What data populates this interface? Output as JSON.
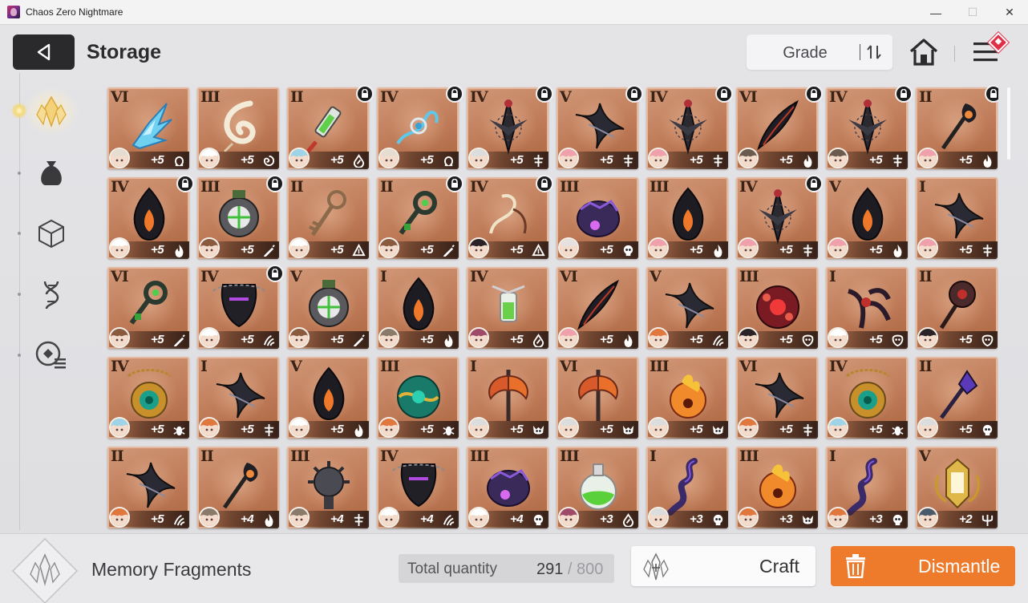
{
  "window": {
    "title": "Chaos Zero Nightmare",
    "minimize_glyph": "—",
    "maximize_glyph": "☐",
    "close_glyph": "✕"
  },
  "header": {
    "title": "Storage",
    "sort_label": "Grade"
  },
  "sidebar": {
    "tabs": [
      {
        "name": "memory-fragments",
        "icon": "crystal-icon",
        "active": true
      },
      {
        "name": "materials",
        "icon": "pouch-icon",
        "active": false
      },
      {
        "name": "items",
        "icon": "cube-icon",
        "active": false
      },
      {
        "name": "genes",
        "icon": "dna-icon",
        "active": false
      },
      {
        "name": "records",
        "icon": "disc-list-icon",
        "active": false
      }
    ]
  },
  "colors": {
    "card_bg": "#c0805d",
    "dismantle": "#ee7a2c",
    "back_button": "#2a2a2c",
    "notification": "#e03048"
  },
  "fragments": [
    {
      "grade": "VI",
      "locked": false,
      "level": "+5",
      "attr": "ohm",
      "art": "blue-crystal"
    },
    {
      "grade": "III",
      "locked": false,
      "level": "+5",
      "attr": "swirl",
      "art": "feather-swirl"
    },
    {
      "grade": "II",
      "locked": true,
      "level": "+5",
      "attr": "drop",
      "art": "green-syringe"
    },
    {
      "grade": "IV",
      "locked": true,
      "level": "+5",
      "attr": "ohm",
      "art": "blue-vines"
    },
    {
      "grade": "IV",
      "locked": true,
      "level": "+5",
      "attr": "cross",
      "art": "dark-blade"
    },
    {
      "grade": "V",
      "locked": true,
      "level": "+5",
      "attr": "cross",
      "art": "dark-claws"
    },
    {
      "grade": "IV",
      "locked": true,
      "level": "+5",
      "attr": "cross",
      "art": "dark-blade"
    },
    {
      "grade": "VI",
      "locked": true,
      "level": "+5",
      "attr": "flame",
      "art": "dark-feather"
    },
    {
      "grade": "IV",
      "locked": true,
      "level": "+5",
      "attr": "cross",
      "art": "dark-blade"
    },
    {
      "grade": "II",
      "locked": true,
      "level": "+5",
      "attr": "flame",
      "art": "dark-staff"
    },
    {
      "grade": "IV",
      "locked": true,
      "level": "+5",
      "attr": "flame",
      "art": "dark-flame"
    },
    {
      "grade": "III",
      "locked": true,
      "level": "+5",
      "attr": "pen",
      "art": "mech-orb"
    },
    {
      "grade": "II",
      "locked": false,
      "level": "+5",
      "attr": "tri",
      "art": "brass-key"
    },
    {
      "grade": "II",
      "locked": true,
      "level": "+5",
      "attr": "pen",
      "art": "green-key"
    },
    {
      "grade": "IV",
      "locked": true,
      "level": "+5",
      "attr": "tri",
      "art": "bone-whip"
    },
    {
      "grade": "III",
      "locked": false,
      "level": "+5",
      "attr": "skull",
      "art": "purple-beast"
    },
    {
      "grade": "III",
      "locked": false,
      "level": "+5",
      "attr": "flame",
      "art": "dark-flame"
    },
    {
      "grade": "IV",
      "locked": true,
      "level": "+5",
      "attr": "cross",
      "art": "dark-blade"
    },
    {
      "grade": "V",
      "locked": false,
      "level": "+5",
      "attr": "flame",
      "art": "dark-flame"
    },
    {
      "grade": "I",
      "locked": false,
      "level": "+5",
      "attr": "cross",
      "art": "dark-claws"
    },
    {
      "grade": "VI",
      "locked": false,
      "level": "+5",
      "attr": "pen",
      "art": "green-key"
    },
    {
      "grade": "IV",
      "locked": true,
      "level": "+5",
      "attr": "claw",
      "art": "chain-helm"
    },
    {
      "grade": "V",
      "locked": false,
      "level": "+5",
      "attr": "pen",
      "art": "mech-orb"
    },
    {
      "grade": "I",
      "locked": false,
      "level": "+5",
      "attr": "flame",
      "art": "dark-flame"
    },
    {
      "grade": "IV",
      "locked": false,
      "level": "+5",
      "attr": "drop",
      "art": "green-vial"
    },
    {
      "grade": "VI",
      "locked": false,
      "level": "+5",
      "attr": "flame",
      "art": "dark-feather"
    },
    {
      "grade": "V",
      "locked": false,
      "level": "+5",
      "attr": "claw",
      "art": "dark-claws"
    },
    {
      "grade": "III",
      "locked": false,
      "level": "+5",
      "attr": "beast",
      "art": "red-orb"
    },
    {
      "grade": "I",
      "locked": false,
      "level": "+5",
      "attr": "beast",
      "art": "red-claws"
    },
    {
      "grade": "II",
      "locked": false,
      "level": "+5",
      "attr": "beast",
      "art": "red-staff"
    },
    {
      "grade": "IV",
      "locked": false,
      "level": "+5",
      "attr": "bug",
      "art": "jade-amulet"
    },
    {
      "grade": "I",
      "locked": false,
      "level": "+5",
      "attr": "cross",
      "art": "dark-claws"
    },
    {
      "grade": "V",
      "locked": false,
      "level": "+5",
      "attr": "flame",
      "art": "dark-flame"
    },
    {
      "grade": "III",
      "locked": false,
      "level": "+5",
      "attr": "bug",
      "art": "jade-orb"
    },
    {
      "grade": "I",
      "locked": false,
      "level": "+5",
      "attr": "demon",
      "art": "fire-axe"
    },
    {
      "grade": "VI",
      "locked": false,
      "level": "+5",
      "attr": "demon",
      "art": "fire-axe"
    },
    {
      "grade": "III",
      "locked": false,
      "level": "+5",
      "attr": "demon",
      "art": "fire-orb"
    },
    {
      "grade": "VI",
      "locked": false,
      "level": "+5",
      "attr": "cross",
      "art": "dark-claws"
    },
    {
      "grade": "IV",
      "locked": false,
      "level": "+5",
      "attr": "bug",
      "art": "jade-amulet"
    },
    {
      "grade": "II",
      "locked": false,
      "level": "+5",
      "attr": "skull",
      "art": "purple-staff"
    },
    {
      "grade": "II",
      "locked": false,
      "level": "+5",
      "attr": "claw",
      "art": "dark-claws"
    },
    {
      "grade": "II",
      "locked": false,
      "level": "+4",
      "attr": "flame",
      "art": "dark-staff"
    },
    {
      "grade": "III",
      "locked": false,
      "level": "+4",
      "attr": "cross",
      "art": "spike-mace"
    },
    {
      "grade": "IV",
      "locked": false,
      "level": "+4",
      "attr": "claw",
      "art": "chain-helm"
    },
    {
      "grade": "III",
      "locked": false,
      "level": "+4",
      "attr": "skull",
      "art": "purple-beast"
    },
    {
      "grade": "III",
      "locked": false,
      "level": "+3",
      "attr": "drop",
      "art": "green-flask"
    },
    {
      "grade": "I",
      "locked": false,
      "level": "+3",
      "attr": "skull",
      "art": "purple-serpent"
    },
    {
      "grade": "III",
      "locked": false,
      "level": "+3",
      "attr": "demon",
      "art": "fire-orb"
    },
    {
      "grade": "I",
      "locked": false,
      "level": "+3",
      "attr": "skull",
      "art": "purple-serpent"
    },
    {
      "grade": "V",
      "locked": false,
      "level": "+2",
      "attr": "trident",
      "art": "gold-lantern"
    }
  ],
  "avatar_colors": [
    "#e6ddd2",
    "#ffffff",
    "#9fd3e6",
    "#e6ddd2",
    "#dcdcdc",
    "#f0a0aa",
    "#f0a0aa",
    "#6b5a4e",
    "#6b5a4e",
    "#f0a0aa",
    "#ffffff",
    "#8a5a3e",
    "#ffffff",
    "#8a5a3e",
    "#2a2226",
    "#e6e0e0",
    "#f0a0aa",
    "#f0a0aa",
    "#f0a0aa",
    "#f0a0aa",
    "#8a5a3e",
    "#ffffff",
    "#8a5a3e",
    "#8a7a6a",
    "#a04a6a",
    "#f0a0aa",
    "#e0783e",
    "#2a2226",
    "#ffffff",
    "#2a2226",
    "#9fd3e6",
    "#e0783e",
    "#ffffff",
    "#e0783e",
    "#dcdcdc",
    "#dcdcdc",
    "#dcdcdc",
    "#e0783e",
    "#9fd3e6",
    "#dcdcdc",
    "#e0783e",
    "#8a7a6a",
    "#8a7a6a",
    "#ffffff",
    "#ffffff",
    "#a04a6a",
    "#dcdcdc",
    "#e0783e",
    "#e0783e",
    "#4a5a6a"
  ],
  "bottom": {
    "category_label": "Memory Fragments",
    "total_label": "Total quantity",
    "total_current": "291",
    "total_separator": " / ",
    "total_max": "800",
    "craft_label": "Craft",
    "dismantle_label": "Dismantle"
  }
}
